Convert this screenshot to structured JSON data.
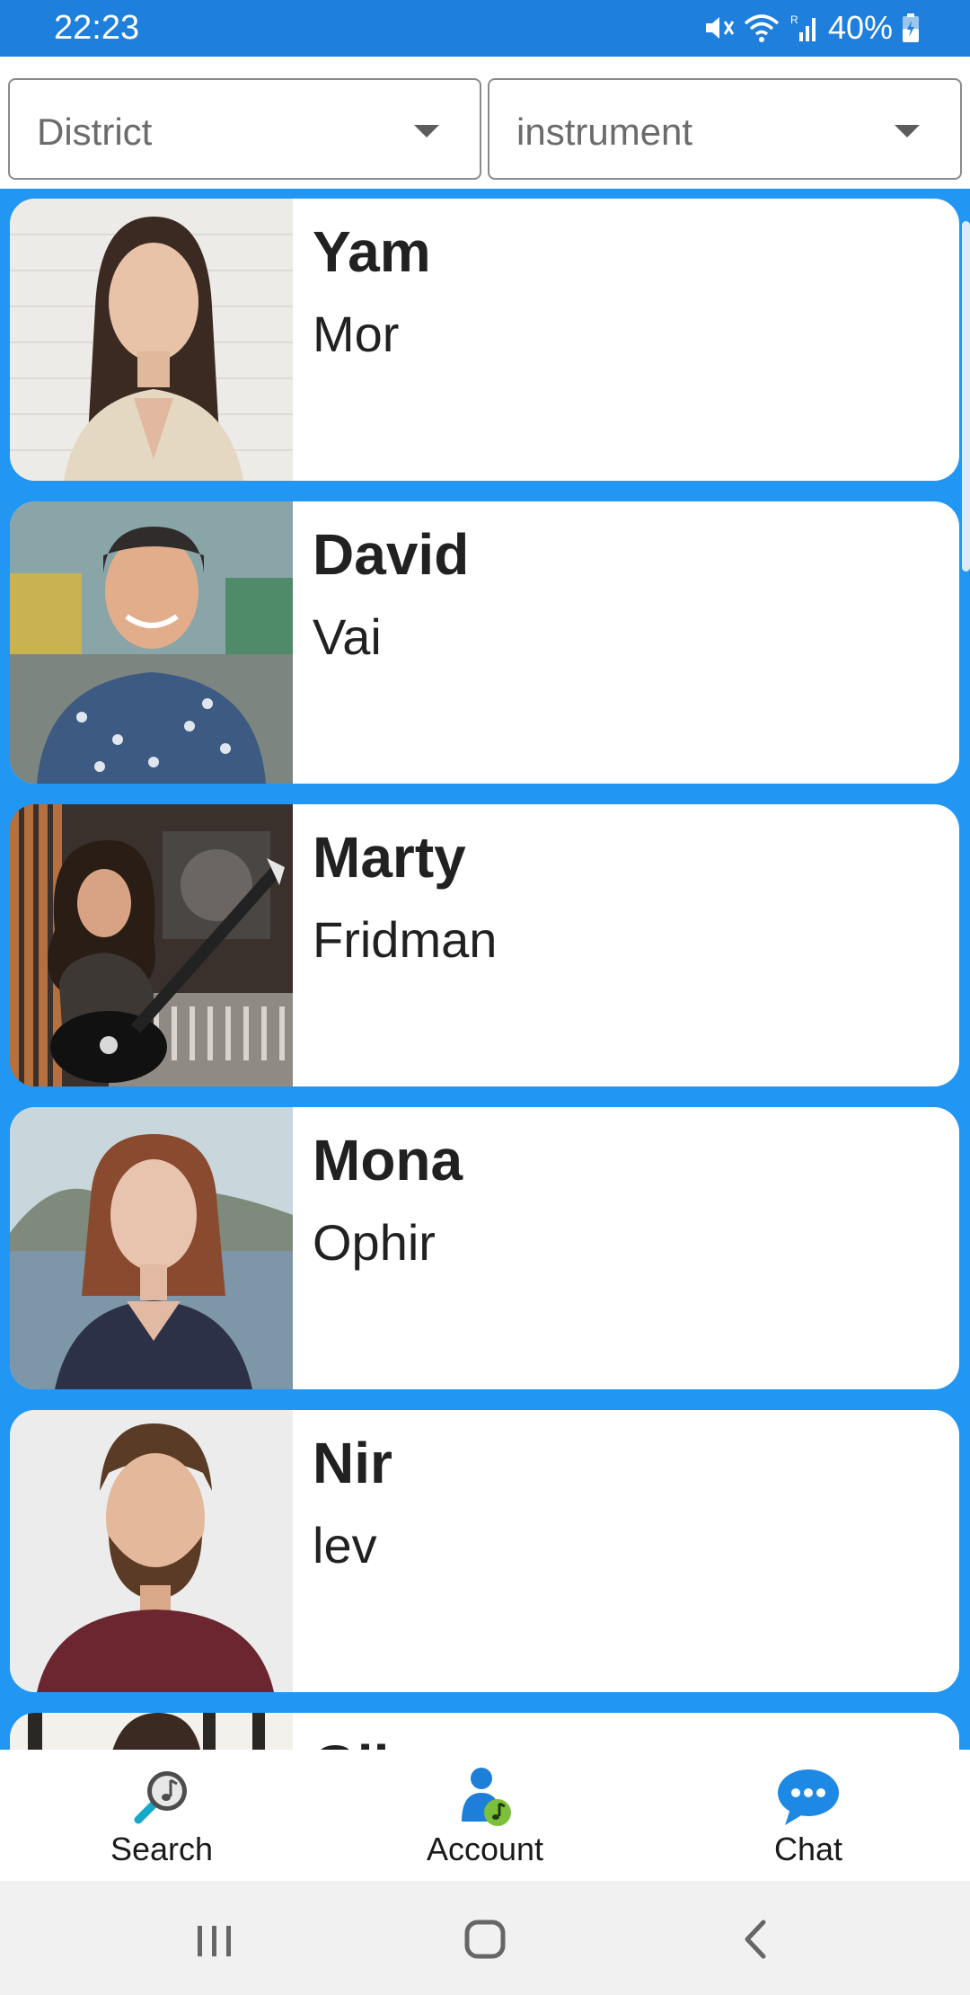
{
  "status_bar": {
    "time": "22:23",
    "battery": "40%",
    "roaming_indicator": "R"
  },
  "filters": {
    "district": {
      "label": "District",
      "icon": "dropdown-arrow-icon"
    },
    "instrument": {
      "label": "instrument",
      "icon": "dropdown-arrow-icon"
    }
  },
  "musicians": [
    {
      "first_name": "Yam",
      "last_name": "Mor"
    },
    {
      "first_name": "David",
      "last_name": "Vai"
    },
    {
      "first_name": "Marty",
      "last_name": "Fridman"
    },
    {
      "first_name": "Mona",
      "last_name": "Ophir"
    },
    {
      "first_name": "Nir",
      "last_name": "lev"
    },
    {
      "first_name": "Gil",
      "last_name": ""
    }
  ],
  "bottom_nav": [
    {
      "label": "Search",
      "icon": "music-search-icon"
    },
    {
      "label": "Account",
      "icon": "account-icon"
    },
    {
      "label": "Chat",
      "icon": "chat-bubble-icon"
    }
  ],
  "colors": {
    "accent": "#2196F3",
    "status_bar": "#1E7FDC",
    "card": "#ffffff",
    "text": "#212121"
  }
}
